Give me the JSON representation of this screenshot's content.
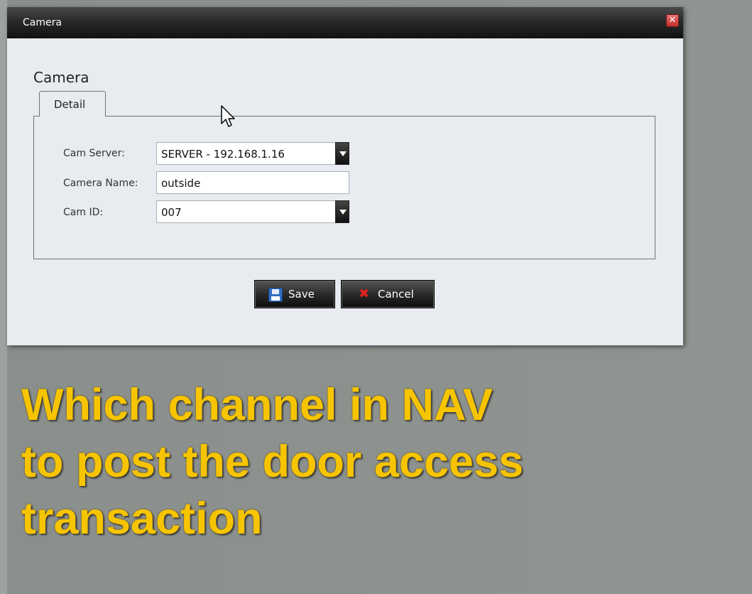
{
  "window": {
    "title": "Camera",
    "close_symbol": "✕"
  },
  "form": {
    "heading": "Camera",
    "tabs": [
      {
        "label": "Detail",
        "active": true
      }
    ],
    "fields": {
      "cam_server": {
        "label": "Cam Server:",
        "value": "SERVER - 192.168.1.16",
        "type": "select"
      },
      "camera_name": {
        "label": "Camera Name:",
        "value": "outside",
        "type": "text"
      },
      "cam_id": {
        "label": "Cam ID:",
        "value": "007",
        "type": "select"
      }
    }
  },
  "buttons": {
    "save_label": "Save",
    "save_icon": "floppy-disk-icon",
    "cancel_label": "Cancel",
    "cancel_icon": "red-x-icon",
    "cancel_symbol": "✖"
  },
  "overlay": {
    "lines": [
      "Which channel in NAV",
      "to post the door access",
      "transaction"
    ],
    "color": "#f7c400"
  },
  "colors": {
    "titlebar": "#1a1a1a",
    "dialog_bg": "#e8ecf0",
    "page_bg": "#8d928f"
  }
}
